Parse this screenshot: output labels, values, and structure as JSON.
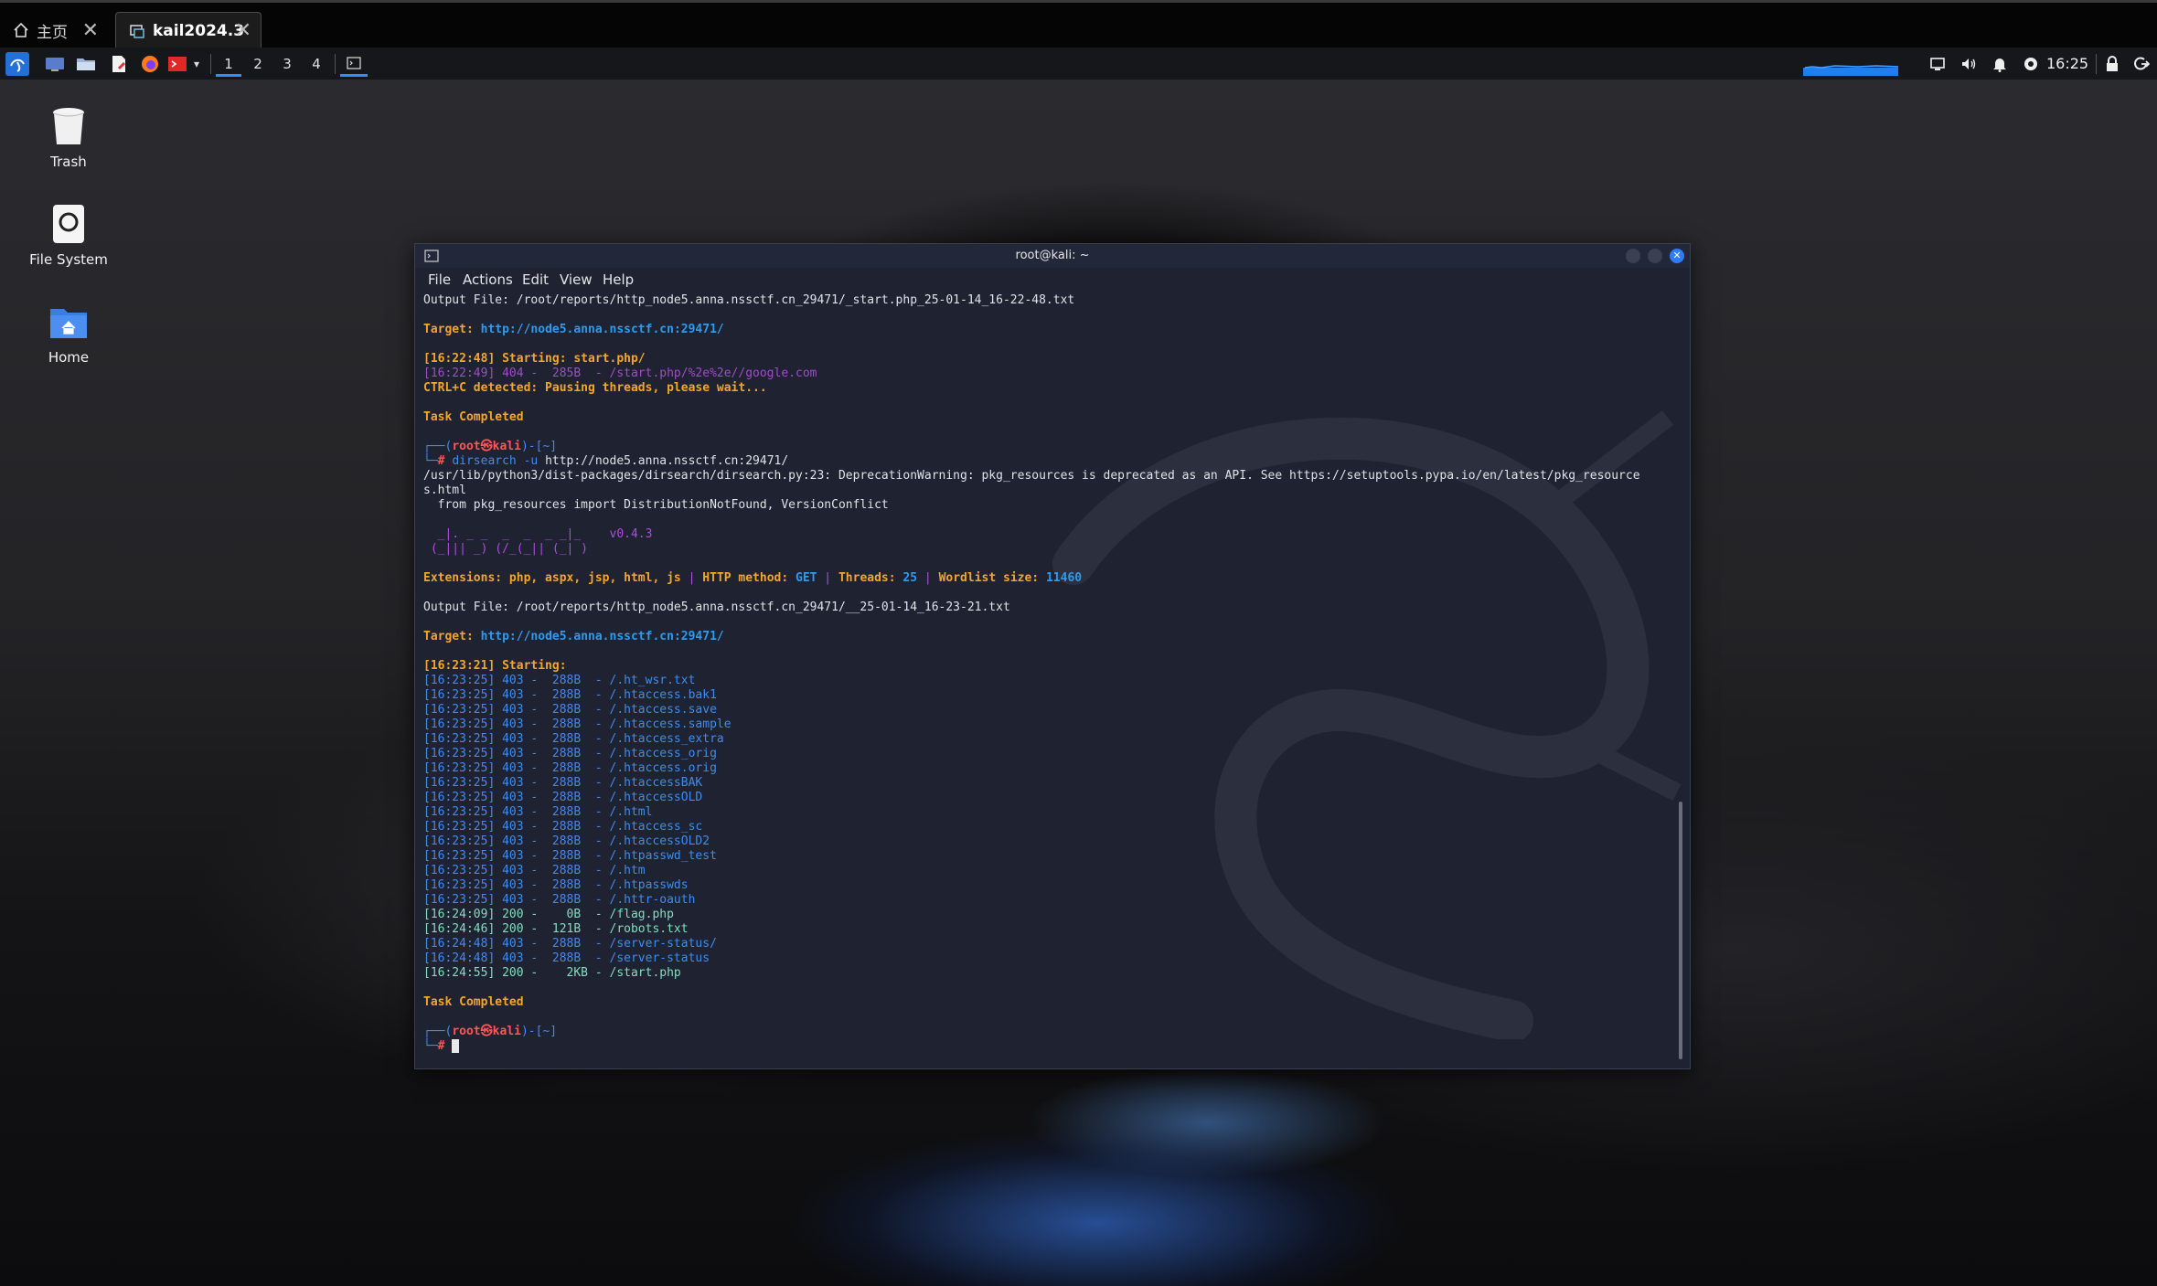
{
  "host_tabs": [
    {
      "label": "主页",
      "icon": "home-icon"
    },
    {
      "label": "kail2024.3",
      "icon": "vm-icon"
    }
  ],
  "panel": {
    "workspaces": [
      "1",
      "2",
      "3",
      "4"
    ],
    "clock": "16:25"
  },
  "desktop_icons": [
    {
      "label": "Trash",
      "icon": "trash-icon"
    },
    {
      "label": "File System",
      "icon": "drive-icon"
    },
    {
      "label": "Home",
      "icon": "home-folder-icon"
    }
  ],
  "terminal": {
    "title": "root@kali: ~",
    "menu": [
      "File",
      "Actions",
      "Edit",
      "View",
      "Help"
    ],
    "lines": [
      [
        [
          "w",
          "Output File: /root/reports/http_node5.anna.nssctf.cn_29471/_start.php_25-01-14_16-22-48.txt"
        ]
      ],
      [],
      [
        [
          "y",
          "Target: "
        ],
        [
          "b",
          "http://node5.anna.nssctf.cn:29471/"
        ]
      ],
      [],
      [
        [
          "y",
          "[16:22:48] Starting: start.php/"
        ]
      ],
      [
        [
          "m",
          "[16:22:49] 404 -  285B  - /start.php/%2e%2e//google.com"
        ]
      ],
      [
        [
          "y",
          "CTRL+C detected: Pausing threads, please wait..."
        ]
      ],
      [],
      [
        [
          "y",
          "Task Completed"
        ]
      ],
      [],
      [
        [
          "bl",
          "┌──("
        ],
        [
          "rd",
          "root㉿kali"
        ],
        [
          "bl",
          ")-[~]"
        ]
      ],
      [
        [
          "bl",
          "└─"
        ],
        [
          "rd",
          "# "
        ],
        [
          "bl",
          "dirsearch -u "
        ],
        [
          "w",
          "http://node5.anna.nssctf.cn:29471/"
        ]
      ],
      [
        [
          "w",
          "/usr/lib/python3/dist-packages/dirsearch/dirsearch.py:23: DeprecationWarning: pkg_resources is deprecated as an API. See https://setuptools.pypa.io/en/latest/pkg_resource"
        ]
      ],
      [
        [
          "w",
          "s.html"
        ]
      ],
      [
        [
          "w",
          "  from pkg_resources import DistributionNotFound, VersionConflict"
        ]
      ],
      [],
      [
        [
          "p",
          "  _|. _ _  _  _  _ _|_    "
        ],
        [
          "p",
          "v0.4.3"
        ]
      ],
      [
        [
          "p",
          " (_||| _) (/_(_|| (_| )"
        ]
      ],
      [],
      [
        [
          "y",
          "Extensions: "
        ],
        [
          "y",
          "php, aspx, jsp, html, js"
        ],
        [
          "p",
          " | "
        ],
        [
          "y",
          "HTTP method: "
        ],
        [
          "b",
          "GET"
        ],
        [
          "p",
          " | "
        ],
        [
          "y",
          "Threads: "
        ],
        [
          "b",
          "25"
        ],
        [
          "p",
          " | "
        ],
        [
          "y",
          "Wordlist size: "
        ],
        [
          "b",
          "11460"
        ]
      ],
      [],
      [
        [
          "w",
          "Output File: /root/reports/http_node5.anna.nssctf.cn_29471/__25-01-14_16-23-21.txt"
        ]
      ],
      [],
      [
        [
          "y",
          "Target: "
        ],
        [
          "b",
          "http://node5.anna.nssctf.cn:29471/"
        ]
      ],
      [],
      [
        [
          "y",
          "[16:23:21] Starting: "
        ]
      ],
      [
        [
          "bl",
          "[16:23:25] 403 -  288B  - /.ht_wsr.txt"
        ]
      ],
      [
        [
          "bl",
          "[16:23:25] 403 -  288B  - /.htaccess.bak1"
        ]
      ],
      [
        [
          "bl",
          "[16:23:25] 403 -  288B  - /.htaccess.save"
        ]
      ],
      [
        [
          "bl",
          "[16:23:25] 403 -  288B  - /.htaccess.sample"
        ]
      ],
      [
        [
          "bl",
          "[16:23:25] 403 -  288B  - /.htaccess_extra"
        ]
      ],
      [
        [
          "bl",
          "[16:23:25] 403 -  288B  - /.htaccess_orig"
        ]
      ],
      [
        [
          "bl",
          "[16:23:25] 403 -  288B  - /.htaccess.orig"
        ]
      ],
      [
        [
          "bl",
          "[16:23:25] 403 -  288B  - /.htaccessBAK"
        ]
      ],
      [
        [
          "bl",
          "[16:23:25] 403 -  288B  - /.htaccessOLD"
        ]
      ],
      [
        [
          "bl",
          "[16:23:25] 403 -  288B  - /.html"
        ]
      ],
      [
        [
          "bl",
          "[16:23:25] 403 -  288B  - /.htaccess_sc"
        ]
      ],
      [
        [
          "bl",
          "[16:23:25] 403 -  288B  - /.htaccessOLD2"
        ]
      ],
      [
        [
          "bl",
          "[16:23:25] 403 -  288B  - /.htpasswd_test"
        ]
      ],
      [
        [
          "bl",
          "[16:23:25] 403 -  288B  - /.htm"
        ]
      ],
      [
        [
          "bl",
          "[16:23:25] 403 -  288B  - /.htpasswds"
        ]
      ],
      [
        [
          "bl",
          "[16:23:25] 403 -  288B  - /.httr-oauth"
        ]
      ],
      [
        [
          "gr",
          "[16:24:09] 200 -    0B  - /flag.php"
        ]
      ],
      [
        [
          "gr",
          "[16:24:46] 200 -  121B  - /robots.txt"
        ]
      ],
      [
        [
          "bl",
          "[16:24:48] 403 -  288B  - /server-status/"
        ]
      ],
      [
        [
          "bl",
          "[16:24:48] 403 -  288B  - /server-status"
        ]
      ],
      [
        [
          "gr",
          "[16:24:55] 200 -    2KB - /start.php"
        ]
      ],
      [],
      [
        [
          "y",
          "Task Completed"
        ]
      ],
      [],
      [
        [
          "bl",
          "┌──("
        ],
        [
          "rd",
          "root㉿kali"
        ],
        [
          "bl",
          ")-[~]"
        ]
      ],
      [
        [
          "bl",
          "└─"
        ],
        [
          "rd",
          "# "
        ],
        [
          "cursor",
          " "
        ]
      ]
    ]
  }
}
